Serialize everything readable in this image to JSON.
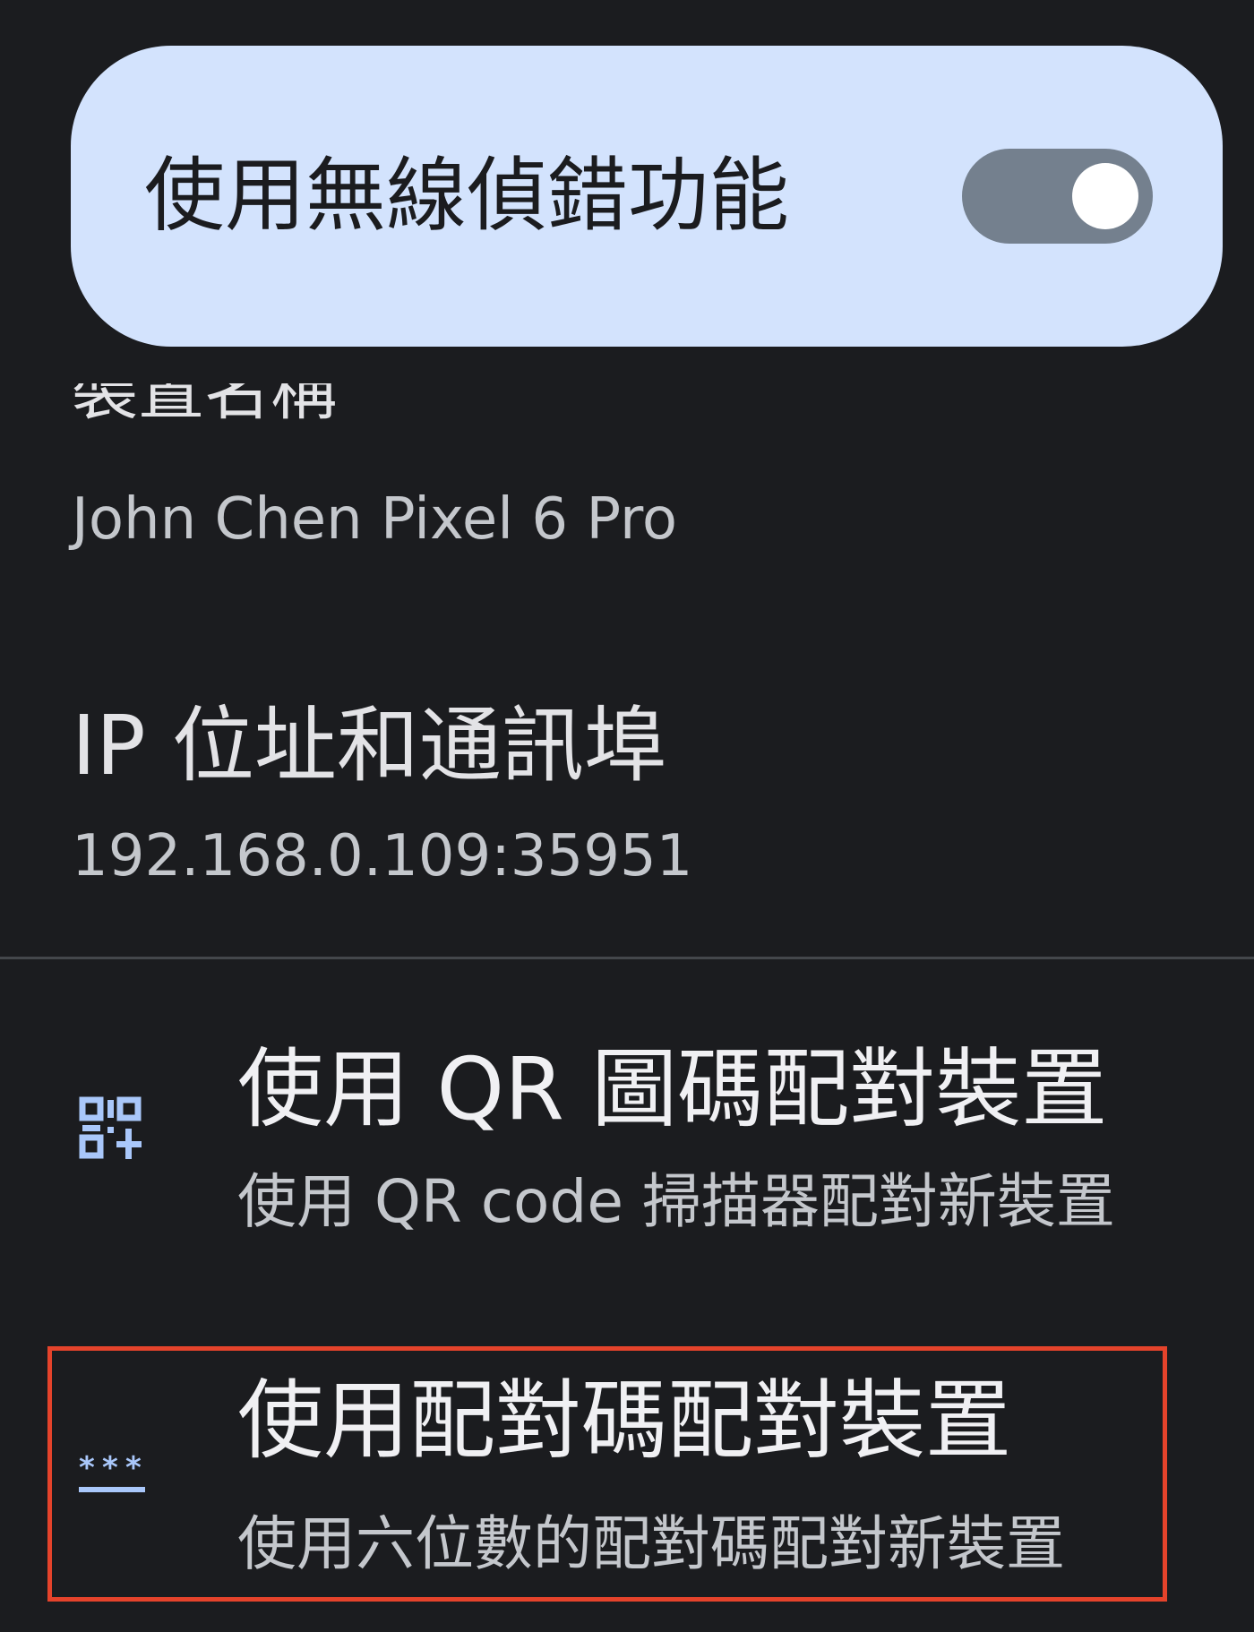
{
  "wireless_debugging": {
    "label": "使用無線偵錯功能",
    "enabled": true
  },
  "device_name": {
    "title": "裝置名稱",
    "value": "John Chen Pixel 6 Pro"
  },
  "ip_port": {
    "title": "IP 位址和通訊埠",
    "value": "192.168.0.109:35951"
  },
  "pair_qr": {
    "title": "使用 QR 圖碼配對裝置",
    "subtitle": "使用 QR code 掃描器配對新裝置",
    "icon": "qr-code-scanner-icon"
  },
  "pair_code": {
    "title": "使用配對碼配對裝置",
    "subtitle": "使用六位數的配對碼配對新裝置",
    "icon": "password-dots-icon",
    "highlighted": true
  },
  "colors": {
    "background": "#1b1c1f",
    "toggle_card": "#d3e3fd",
    "switch_track": "#74808e",
    "icon_accent": "#a9c7fa",
    "highlight_border": "#e5432b"
  }
}
